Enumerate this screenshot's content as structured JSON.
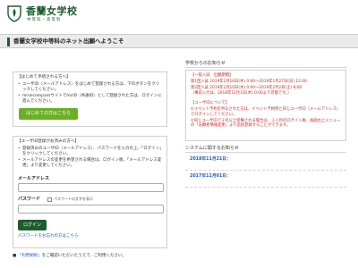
{
  "header": {
    "school_name": "香蘭女学校",
    "subtitle": "中等科・高等科"
  },
  "banner": {
    "title": "香蘭女学校中等科のネット出願へようこそ"
  },
  "first_time": {
    "heading": "【はじめて手続される方へ】",
    "items": [
      "ユーザID（メールアドレス）をはじめて登録される方は、下のボタンをクリックしてください。",
      "miraicompassサイトでmcID（共通ID）として登録された方は、ログインに進んでください。"
    ],
    "button_label": "はじめての方はこちら"
  },
  "registered": {
    "heading": "【ユーザID登録がお済みの方へ】",
    "items": [
      "登録済みのユーザID（メールアドレス）、パスワードを入力の上、「ログイン」をクリックしてください。",
      "メールアドレスの変更を希望される場合は、ログイン後、「メールアドレス変更」より変更してください。"
    ],
    "email_label": "メールアドレス",
    "password_label": "パスワード",
    "show_password_label": "パスワードの文字を表示",
    "login_label": "ログイン",
    "forgot_link": "パスワードをお忘れの方はこちら"
  },
  "terms": {
    "link_text": "「利用規約」",
    "suffix": "をご確認いただいたうえで、ご利用ください。"
  },
  "school_notices": {
    "title": "学校からのお知らせ",
    "lines": [
      "【一般入試　出願期間】",
      "第1回入試 2019年1月10日(木) 0:00～2019年1月27日(日) 12:00",
      "第2回入試 2019年1月10日(木) 0:00～2019年2月2日(土) 8:00",
      "（事前入力は、2018年12月1日(木) 0:00より可能です。）",
      "",
      "【ユーザIDについて】",
      "①イベント予約を申込された方は、イベント予約時と同じユーザID（メールアドレス）でログインしてください。",
      "②同じユーザIDで２名以上受験される場合は、１人目のログイン後、画面右上メニューの「志願者情報変更」より追加登録することができます。"
    ]
  },
  "system_notices": {
    "title": "システムに関するお知らせ",
    "dates": [
      "2018年11月21日：",
      "2017年11月01日："
    ]
  }
}
